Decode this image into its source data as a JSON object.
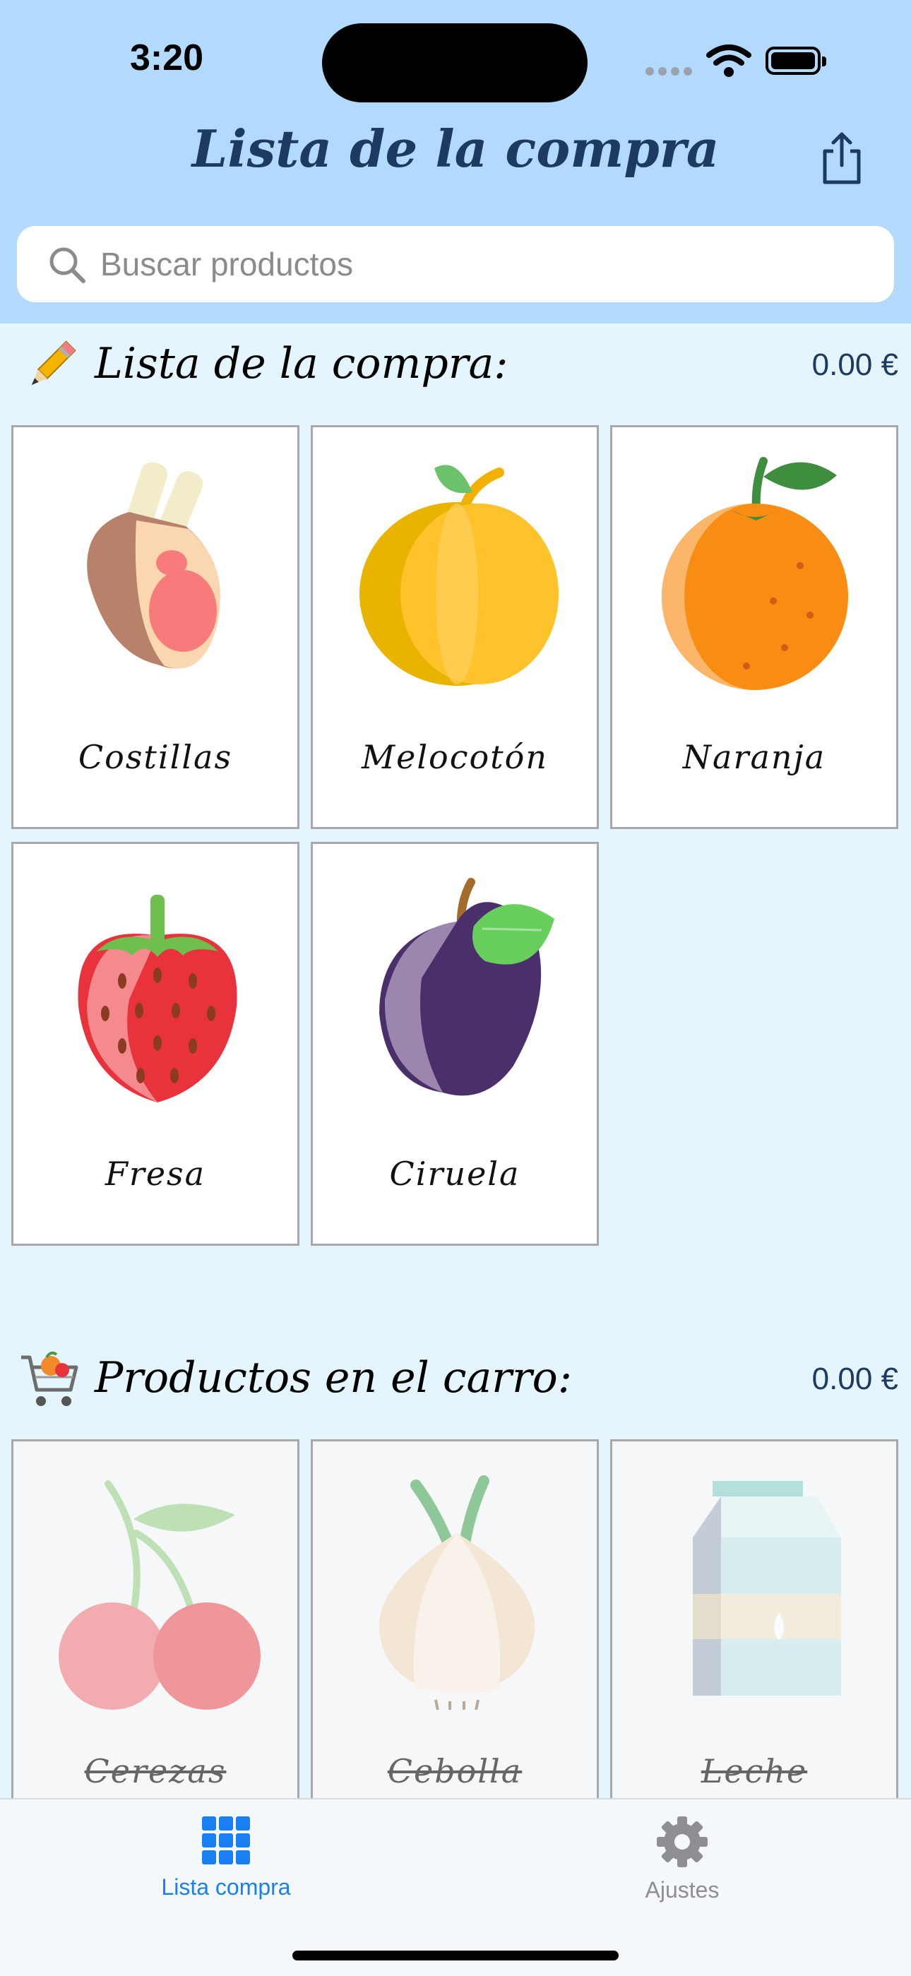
{
  "status_bar": {
    "time": "3:20"
  },
  "header": {
    "title": "Lista de la compra",
    "share_icon": "share-icon"
  },
  "search": {
    "placeholder": "Buscar productos",
    "value": ""
  },
  "shopping_list": {
    "title": "Lista de la compra:",
    "total": "0.00 €",
    "emoji_icon": "pencil-icon",
    "items": [
      {
        "label": "Costillas",
        "icon": "ribs-icon"
      },
      {
        "label": "Melocotón",
        "icon": "peach-icon"
      },
      {
        "label": "Naranja",
        "icon": "orange-icon"
      },
      {
        "label": "Fresa",
        "icon": "strawberry-icon"
      },
      {
        "label": "Ciruela",
        "icon": "plum-icon"
      }
    ]
  },
  "cart": {
    "title": "Productos en el carro:",
    "total": "0.00 €",
    "emoji_icon": "cart-icon",
    "items": [
      {
        "label": "Cerezas",
        "icon": "cherries-icon"
      },
      {
        "label": "Cebolla",
        "icon": "onion-icon"
      },
      {
        "label": "Leche",
        "icon": "milk-icon"
      }
    ]
  },
  "tabbar": {
    "tabs": [
      {
        "label": "Lista compra",
        "icon": "grid-icon",
        "active": true,
        "color": "#1a7ff2"
      },
      {
        "label": "Ajustes",
        "icon": "gear-icon",
        "active": false,
        "color": "#8e8e93"
      }
    ]
  }
}
